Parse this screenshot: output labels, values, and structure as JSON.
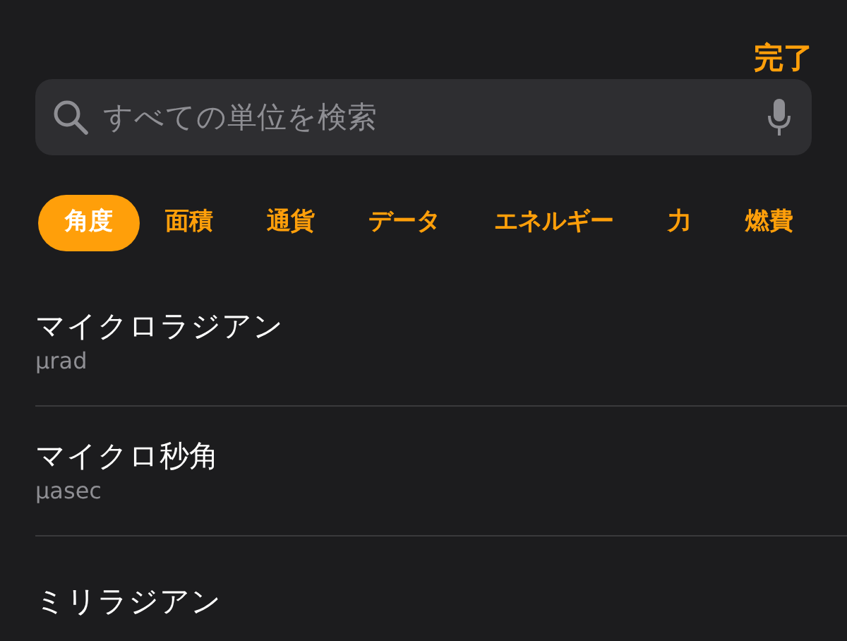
{
  "done_button": "完了",
  "search": {
    "placeholder": "すべての単位を検索"
  },
  "categories": [
    {
      "label": "角度",
      "selected": true
    },
    {
      "label": "面積",
      "selected": false
    },
    {
      "label": "通貨",
      "selected": false
    },
    {
      "label": "データ",
      "selected": false
    },
    {
      "label": "エネルギー",
      "selected": false
    },
    {
      "label": "力",
      "selected": false
    },
    {
      "label": "燃費",
      "selected": false
    }
  ],
  "units": [
    {
      "name": "マイクロラジアン",
      "symbol": "µrad"
    },
    {
      "name": "マイクロ秒角",
      "symbol": "µasec"
    },
    {
      "name": "ミリラジアン"
    }
  ]
}
